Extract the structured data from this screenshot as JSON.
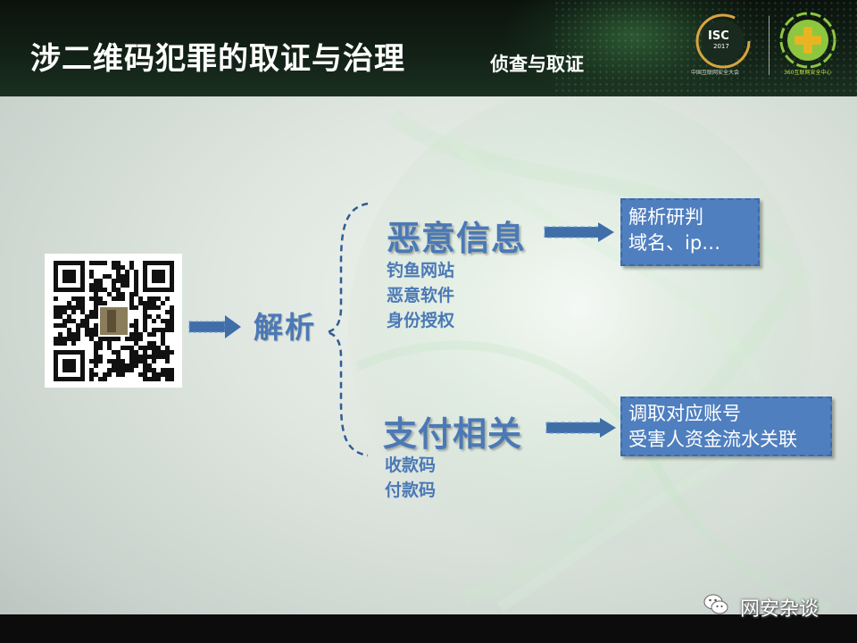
{
  "header": {
    "title": "涉二维码犯罪的取证与治理",
    "subtitle": "侦查与取证",
    "isc_logo": {
      "text": "ISC",
      "year": "2017",
      "caption": "中国互联网安全大会"
    },
    "partner_logo": {
      "caption": "360互联网安全中心"
    }
  },
  "diagram": {
    "source_label": "解析",
    "branches": [
      {
        "heading": "恶意信息",
        "items": [
          "钓鱼网站",
          "恶意软件",
          "身份授权"
        ],
        "result_lines": [
          "解析研判",
          "域名、ip…"
        ]
      },
      {
        "heading": "支付相关",
        "items": [
          "收款码",
          "付款码"
        ],
        "result_lines": [
          "调取对应账号",
          "受害人资金流水关联"
        ]
      }
    ]
  },
  "watermark": {
    "text": "网安杂谈",
    "icon": "wechat-icon"
  },
  "colors": {
    "accent": "#4b79b6",
    "box_fill": "#4f7fbf",
    "header_bg": "#132217",
    "logo_green": "#8dc63f"
  }
}
